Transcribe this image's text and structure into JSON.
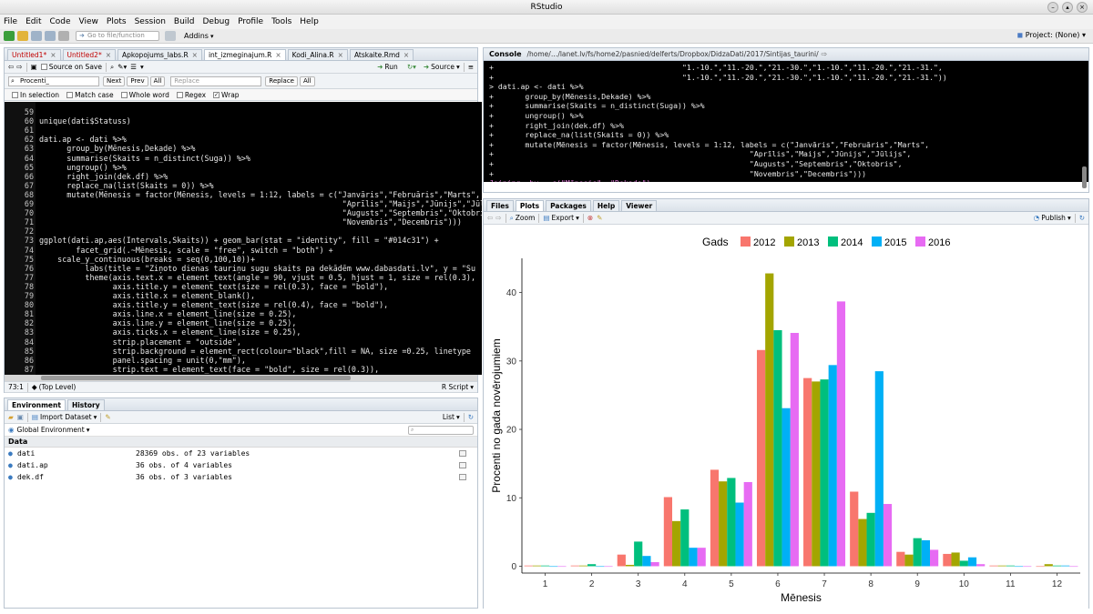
{
  "window": {
    "title": "RStudio"
  },
  "menu": [
    "File",
    "Edit",
    "Code",
    "View",
    "Plots",
    "Session",
    "Build",
    "Debug",
    "Profile",
    "Tools",
    "Help"
  ],
  "toolbar": {
    "goto_placeholder": "Go to file/function",
    "addins": "Addins",
    "project": "Project: (None)"
  },
  "editor": {
    "tabs": [
      {
        "label": "Untitled1*",
        "red": true
      },
      {
        "label": "Untitled2*",
        "red": true
      },
      {
        "label": "Apkopojums_labs.R",
        "red": false
      },
      {
        "label": "int_izmeginajum.R",
        "red": false
      },
      {
        "label": "Kodi_Alina.R",
        "red": false
      },
      {
        "label": "Atskaite.Rmd",
        "red": false
      }
    ],
    "source_on_save": "Source on Save",
    "run": "Run",
    "source": "Source",
    "find_value": "Procenti_",
    "find_next": "Next",
    "find_prev": "Prev",
    "find_all": "All",
    "replace_placeholder": "Replace",
    "replace_btn": "Replace",
    "replace_all": "All",
    "opts": [
      "In selection",
      "Match case",
      "Whole word",
      "Regex",
      "Wrap"
    ],
    "lines": [
      {
        "n": "59",
        "t": ""
      },
      {
        "n": "60",
        "t": "unique(dati$Statuss)"
      },
      {
        "n": "61",
        "t": ""
      },
      {
        "n": "62",
        "t": "dati.ap <- dati %>%"
      },
      {
        "n": "63",
        "t": "      group_by(Mēnesis,Dekade) %>%"
      },
      {
        "n": "64",
        "t": "      summarise(Skaits = n_distinct(Suga)) %>%"
      },
      {
        "n": "65",
        "t": "      ungroup() %>%"
      },
      {
        "n": "66",
        "t": "      right_join(dek.df) %>%"
      },
      {
        "n": "67",
        "t": "      replace_na(list(Skaits = 0)) %>%"
      },
      {
        "n": "68",
        "t": "      mutate(Mēnesis = factor(Mēnesis, levels = 1:12, labels = c(\"Janvāris\",\"Februāris\",\"Marts\","
      },
      {
        "n": "69",
        "t": "                                                                  \"Aprīlis\",\"Maijs\",\"Jūnijs\",\"Jūlij"
      },
      {
        "n": "70",
        "t": "                                                                  \"Augusts\",\"Septembris\",\"Oktobris"
      },
      {
        "n": "71",
        "t": "                                                                  \"Novembris\",\"Decembris\")))"
      },
      {
        "n": "72",
        "t": ""
      },
      {
        "n": "73",
        "t": "ggplot(dati.ap,aes(Intervals,Skaits)) + geom_bar(stat = \"identity\", fill = \"#014c31\") +"
      },
      {
        "n": "74",
        "t": "        facet_grid(.~Mēnesis, scale = \"free\", switch = \"both\") +"
      },
      {
        "n": "75",
        "t": "    scale_y_continuous(breaks = seq(0,100,10))+"
      },
      {
        "n": "76",
        "t": "          labs(title = \"Ziņoto dienas tauriņu sugu skaits pa dekādēm www.dabasdati.lv\", y = \"Su"
      },
      {
        "n": "77",
        "t": "          theme(axis.text.x = element_text(angle = 90, vjust = 0.5, hjust = 1, size = rel(0.3),"
      },
      {
        "n": "78",
        "t": "                axis.title.y = element_text(size = rel(0.3), face = \"bold\"),"
      },
      {
        "n": "79",
        "t": "                axis.title.x = element_blank(),"
      },
      {
        "n": "80",
        "t": "                axis.title.y = element_text(size = rel(0.4), face = \"bold\"),"
      },
      {
        "n": "81",
        "t": "                axis.line.x = element_line(size = 0.25),"
      },
      {
        "n": "82",
        "t": "                axis.line.y = element_line(size = 0.25),"
      },
      {
        "n": "83",
        "t": "                axis.ticks.x = element_line(size = 0.25),"
      },
      {
        "n": "84",
        "t": "                strip.placement = \"outside\","
      },
      {
        "n": "85",
        "t": "                strip.background = element_rect(colour=\"black\",fill = NA, size =0.25, linetype"
      },
      {
        "n": "86",
        "t": "                panel.spacing = unit(0,\"mm\"),"
      },
      {
        "n": "87",
        "t": "                strip.text = element_text(face = \"bold\", size = rel(0.3)),"
      },
      {
        "n": "88",
        "t": ""
      }
    ],
    "status_pos": "73:1",
    "status_level": "(Top Level)",
    "status_type": "R Script"
  },
  "console": {
    "title": "Console",
    "path": "/home/…/lanet.lv/fs/home2/pasnied/delferts/Dropbox/DidzaDati/2017/Sintijas_taurini/",
    "lines": [
      {
        "t": "+                                          \"1.-10.\",\"11.-20.\",\"21.-30.\",\"1.-10.\",\"11.-20.\",\"21.-31.\",",
        "c": ""
      },
      {
        "t": "+                                          \"1.-10.\",\"11.-20.\",\"21.-30.\",\"1.-10.\",\"11.-20.\",\"21.-31.\"))",
        "c": ""
      },
      {
        "t": "> dati.ap <- dati %>%",
        "c": ""
      },
      {
        "t": "+       group_by(Mēnesis,Dekade) %>%",
        "c": ""
      },
      {
        "t": "+       summarise(Skaits = n_distinct(Suga)) %>%",
        "c": ""
      },
      {
        "t": "+       ungroup() %>%",
        "c": ""
      },
      {
        "t": "+       right_join(dek.df) %>%",
        "c": ""
      },
      {
        "t": "+       replace_na(list(Skaits = 0)) %>%",
        "c": ""
      },
      {
        "t": "+       mutate(Mēnesis = factor(Mēnesis, levels = 1:12, labels = c(\"Janvāris\",\"Februāris\",\"Marts\",",
        "c": ""
      },
      {
        "t": "+                                                         \"Aprīlis\",\"Maijs\",\"Jūnijs\",\"Jūlijs\",",
        "c": ""
      },
      {
        "t": "+                                                         \"Augusts\",\"Septembris\",\"Oktobris\",",
        "c": ""
      },
      {
        "t": "+                                                         \"Novembris\",\"Decembris\")))",
        "c": ""
      },
      {
        "t": "Joining, by = c(\"Mēnesis\", \"Dekade\")",
        "c": "join"
      },
      {
        "t": "> ",
        "c": ""
      }
    ]
  },
  "env": {
    "tabs": [
      "Environment",
      "History"
    ],
    "import": "Import Dataset",
    "list": "List",
    "scope": "Global Environment",
    "section": "Data",
    "rows": [
      {
        "name": "dati",
        "value": "28369 obs. of 23 variables"
      },
      {
        "name": "dati.ap",
        "value": "36 obs. of 4 variables"
      },
      {
        "name": "dek.df",
        "value": "36 obs. of 3 variables"
      }
    ]
  },
  "plots": {
    "tabs": [
      "Files",
      "Plots",
      "Packages",
      "Help",
      "Viewer"
    ],
    "zoom": "Zoom",
    "export": "Export",
    "publish": "Publish"
  },
  "chart_data": {
    "type": "bar",
    "legend_title": "Gads",
    "legend_position": "top",
    "xlabel": "Mēnesis",
    "ylabel": "Procenti no gada novērojumiem",
    "ylim": [
      -1,
      45
    ],
    "yticks": [
      0,
      10,
      20,
      30,
      40
    ],
    "categories": [
      "1",
      "2",
      "3",
      "4",
      "5",
      "6",
      "7",
      "8",
      "9",
      "10",
      "11",
      "12"
    ],
    "series": [
      {
        "name": "2012",
        "color": "#f8766d",
        "values": [
          0.1,
          0.1,
          1.7,
          10.1,
          14.1,
          31.6,
          27.5,
          10.9,
          2.1,
          1.8,
          0.1,
          0.0
        ]
      },
      {
        "name": "2013",
        "color": "#a3a500",
        "values": [
          0.1,
          0.1,
          0.2,
          6.6,
          12.4,
          42.8,
          27.0,
          6.9,
          1.7,
          2.0,
          0.1,
          0.3
        ]
      },
      {
        "name": "2014",
        "color": "#00bf7d",
        "values": [
          0.1,
          0.3,
          3.6,
          8.3,
          12.9,
          34.5,
          27.3,
          7.8,
          4.1,
          0.8,
          0.1,
          0.1
        ]
      },
      {
        "name": "2015",
        "color": "#00b0f6",
        "values": [
          0.0,
          0.0,
          1.5,
          2.7,
          9.3,
          23.1,
          29.4,
          28.5,
          3.8,
          1.3,
          0.0,
          0.1
        ]
      },
      {
        "name": "2016",
        "color": "#e76bf3",
        "values": [
          0.0,
          0.0,
          0.6,
          2.7,
          12.3,
          34.1,
          38.7,
          9.1,
          2.4,
          0.3,
          0.0,
          0.0
        ]
      }
    ]
  }
}
